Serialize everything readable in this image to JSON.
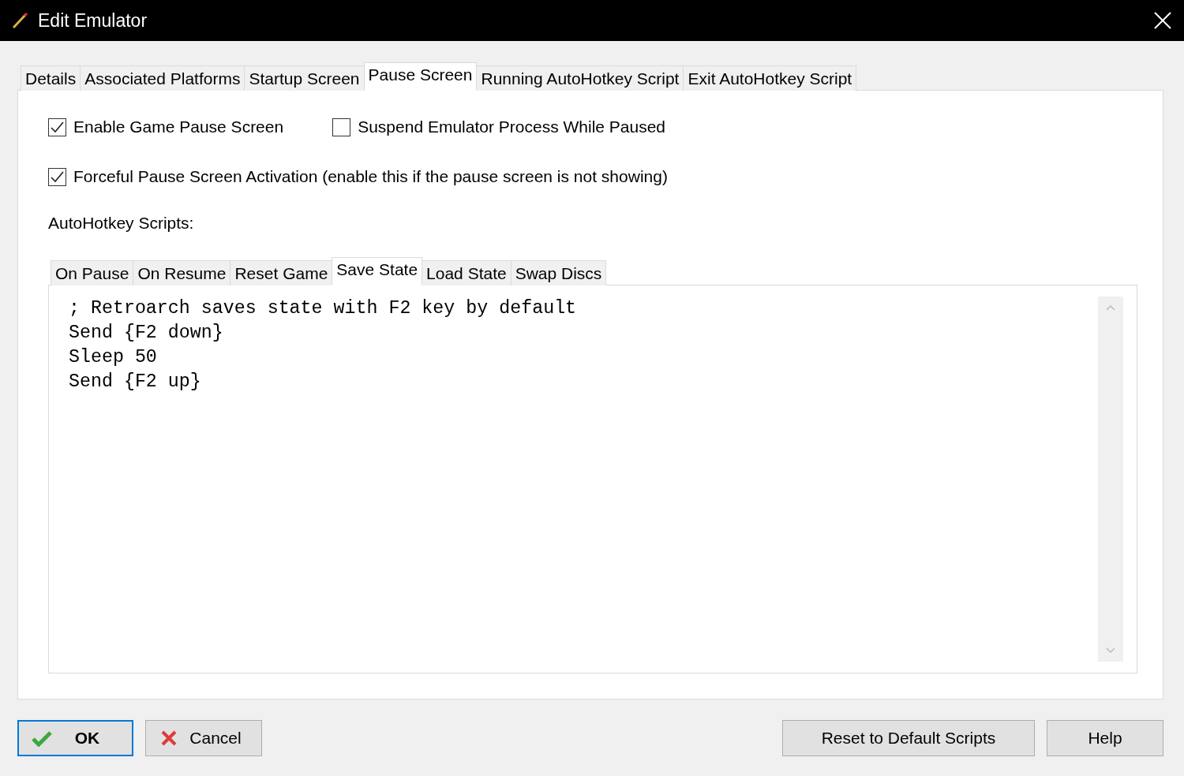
{
  "window": {
    "title": "Edit Emulator"
  },
  "tabs": [
    {
      "label": "Details",
      "selected": false
    },
    {
      "label": "Associated Platforms",
      "selected": false
    },
    {
      "label": "Startup Screen",
      "selected": false
    },
    {
      "label": "Pause Screen",
      "selected": true
    },
    {
      "label": "Running AutoHotkey Script",
      "selected": false
    },
    {
      "label": "Exit AutoHotkey Script",
      "selected": false
    }
  ],
  "options": [
    [
      {
        "label": "Enable Game Pause Screen",
        "checked": true
      },
      {
        "label": "Suspend Emulator Process While Paused",
        "checked": false
      }
    ],
    [
      {
        "label": "Forceful Pause Screen Activation (enable this if the pause screen is not showing)",
        "checked": true
      }
    ]
  ],
  "scripts_label": "AutoHotkey Scripts:",
  "script_tabs": [
    {
      "label": "On Pause",
      "selected": false
    },
    {
      "label": "On Resume",
      "selected": false
    },
    {
      "label": "Reset Game",
      "selected": false
    },
    {
      "label": "Save State",
      "selected": true
    },
    {
      "label": "Load State",
      "selected": false
    },
    {
      "label": "Swap Discs",
      "selected": false
    }
  ],
  "script_lines": [
    "; Retroarch saves state with F2 key by default",
    "Send {F2 down}",
    "Sleep 50",
    "Send {F2 up}"
  ],
  "buttons_left": [
    {
      "label": "OK",
      "kind": "ok",
      "default": true
    },
    {
      "label": "Cancel",
      "kind": "cancel",
      "default": false
    }
  ],
  "buttons_right": [
    {
      "label": "Reset to Default Scripts",
      "kind": "plain",
      "default": false
    },
    {
      "label": "Help",
      "kind": "plain",
      "default": false
    }
  ]
}
